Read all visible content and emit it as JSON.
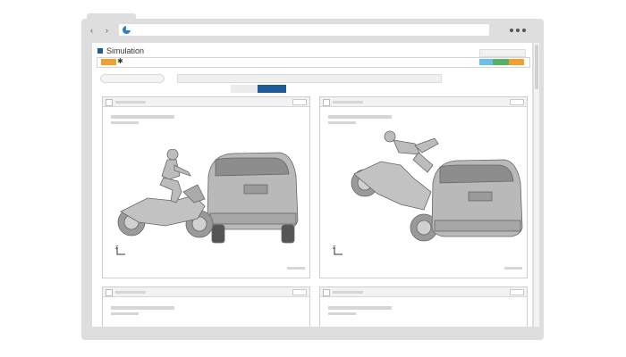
{
  "app": {
    "title": "Simulation",
    "status_icon": "asterisk-icon",
    "status_glyph": "✱"
  },
  "browser": {
    "back": "‹",
    "forward": "›",
    "menu_dots": "•••"
  },
  "toolbar_colors": {
    "orange": "#f0a030",
    "blue": "#6cc0e8",
    "green": "#55b06a",
    "brand": "#1f5b94"
  },
  "panels": [
    {
      "id": "sim-1",
      "scene": "motorcycle-rider-approaching-rear-of-minivan",
      "axis_label": "Z"
    },
    {
      "id": "sim-2",
      "scene": "motorcycle-rider-airborne-after-impact-with-minivan",
      "axis_label": "Z"
    },
    {
      "id": "sim-3"
    },
    {
      "id": "sim-4"
    }
  ]
}
